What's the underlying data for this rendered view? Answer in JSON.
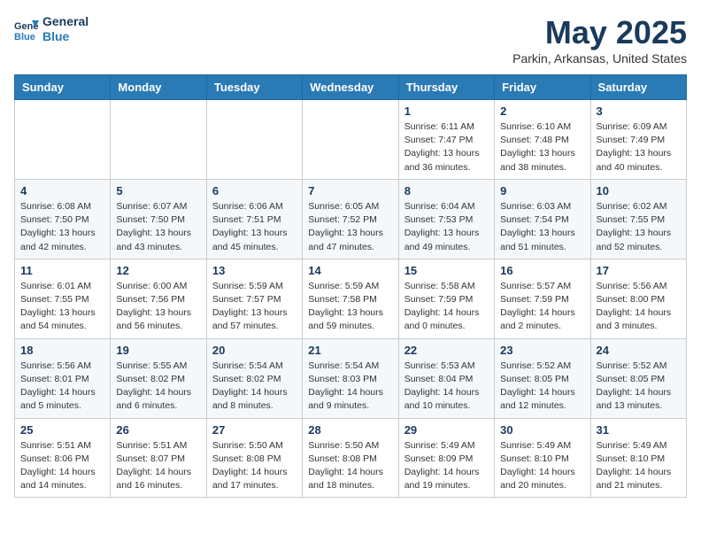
{
  "header": {
    "logo_line1": "General",
    "logo_line2": "Blue",
    "month_title": "May 2025",
    "location": "Parkin, Arkansas, United States"
  },
  "weekdays": [
    "Sunday",
    "Monday",
    "Tuesday",
    "Wednesday",
    "Thursday",
    "Friday",
    "Saturday"
  ],
  "weeks": [
    [
      {
        "day": "",
        "info": ""
      },
      {
        "day": "",
        "info": ""
      },
      {
        "day": "",
        "info": ""
      },
      {
        "day": "",
        "info": ""
      },
      {
        "day": "1",
        "info": "Sunrise: 6:11 AM\nSunset: 7:47 PM\nDaylight: 13 hours\nand 36 minutes."
      },
      {
        "day": "2",
        "info": "Sunrise: 6:10 AM\nSunset: 7:48 PM\nDaylight: 13 hours\nand 38 minutes."
      },
      {
        "day": "3",
        "info": "Sunrise: 6:09 AM\nSunset: 7:49 PM\nDaylight: 13 hours\nand 40 minutes."
      }
    ],
    [
      {
        "day": "4",
        "info": "Sunrise: 6:08 AM\nSunset: 7:50 PM\nDaylight: 13 hours\nand 42 minutes."
      },
      {
        "day": "5",
        "info": "Sunrise: 6:07 AM\nSunset: 7:50 PM\nDaylight: 13 hours\nand 43 minutes."
      },
      {
        "day": "6",
        "info": "Sunrise: 6:06 AM\nSunset: 7:51 PM\nDaylight: 13 hours\nand 45 minutes."
      },
      {
        "day": "7",
        "info": "Sunrise: 6:05 AM\nSunset: 7:52 PM\nDaylight: 13 hours\nand 47 minutes."
      },
      {
        "day": "8",
        "info": "Sunrise: 6:04 AM\nSunset: 7:53 PM\nDaylight: 13 hours\nand 49 minutes."
      },
      {
        "day": "9",
        "info": "Sunrise: 6:03 AM\nSunset: 7:54 PM\nDaylight: 13 hours\nand 51 minutes."
      },
      {
        "day": "10",
        "info": "Sunrise: 6:02 AM\nSunset: 7:55 PM\nDaylight: 13 hours\nand 52 minutes."
      }
    ],
    [
      {
        "day": "11",
        "info": "Sunrise: 6:01 AM\nSunset: 7:55 PM\nDaylight: 13 hours\nand 54 minutes."
      },
      {
        "day": "12",
        "info": "Sunrise: 6:00 AM\nSunset: 7:56 PM\nDaylight: 13 hours\nand 56 minutes."
      },
      {
        "day": "13",
        "info": "Sunrise: 5:59 AM\nSunset: 7:57 PM\nDaylight: 13 hours\nand 57 minutes."
      },
      {
        "day": "14",
        "info": "Sunrise: 5:59 AM\nSunset: 7:58 PM\nDaylight: 13 hours\nand 59 minutes."
      },
      {
        "day": "15",
        "info": "Sunrise: 5:58 AM\nSunset: 7:59 PM\nDaylight: 14 hours\nand 0 minutes."
      },
      {
        "day": "16",
        "info": "Sunrise: 5:57 AM\nSunset: 7:59 PM\nDaylight: 14 hours\nand 2 minutes."
      },
      {
        "day": "17",
        "info": "Sunrise: 5:56 AM\nSunset: 8:00 PM\nDaylight: 14 hours\nand 3 minutes."
      }
    ],
    [
      {
        "day": "18",
        "info": "Sunrise: 5:56 AM\nSunset: 8:01 PM\nDaylight: 14 hours\nand 5 minutes."
      },
      {
        "day": "19",
        "info": "Sunrise: 5:55 AM\nSunset: 8:02 PM\nDaylight: 14 hours\nand 6 minutes."
      },
      {
        "day": "20",
        "info": "Sunrise: 5:54 AM\nSunset: 8:02 PM\nDaylight: 14 hours\nand 8 minutes."
      },
      {
        "day": "21",
        "info": "Sunrise: 5:54 AM\nSunset: 8:03 PM\nDaylight: 14 hours\nand 9 minutes."
      },
      {
        "day": "22",
        "info": "Sunrise: 5:53 AM\nSunset: 8:04 PM\nDaylight: 14 hours\nand 10 minutes."
      },
      {
        "day": "23",
        "info": "Sunrise: 5:52 AM\nSunset: 8:05 PM\nDaylight: 14 hours\nand 12 minutes."
      },
      {
        "day": "24",
        "info": "Sunrise: 5:52 AM\nSunset: 8:05 PM\nDaylight: 14 hours\nand 13 minutes."
      }
    ],
    [
      {
        "day": "25",
        "info": "Sunrise: 5:51 AM\nSunset: 8:06 PM\nDaylight: 14 hours\nand 14 minutes."
      },
      {
        "day": "26",
        "info": "Sunrise: 5:51 AM\nSunset: 8:07 PM\nDaylight: 14 hours\nand 16 minutes."
      },
      {
        "day": "27",
        "info": "Sunrise: 5:50 AM\nSunset: 8:08 PM\nDaylight: 14 hours\nand 17 minutes."
      },
      {
        "day": "28",
        "info": "Sunrise: 5:50 AM\nSunset: 8:08 PM\nDaylight: 14 hours\nand 18 minutes."
      },
      {
        "day": "29",
        "info": "Sunrise: 5:49 AM\nSunset: 8:09 PM\nDaylight: 14 hours\nand 19 minutes."
      },
      {
        "day": "30",
        "info": "Sunrise: 5:49 AM\nSunset: 8:10 PM\nDaylight: 14 hours\nand 20 minutes."
      },
      {
        "day": "31",
        "info": "Sunrise: 5:49 AM\nSunset: 8:10 PM\nDaylight: 14 hours\nand 21 minutes."
      }
    ]
  ]
}
